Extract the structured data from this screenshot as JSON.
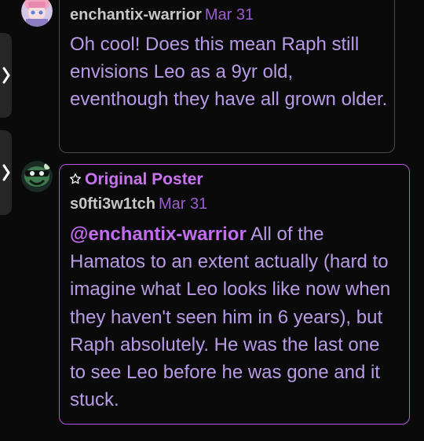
{
  "comments": [
    {
      "username": "enchantix-warrior",
      "date": "Mar 31",
      "text": "Oh cool! Does this mean Raph still envisions Leo as a 9yr old, eventhough they have all grown older."
    },
    {
      "badge": "Original Poster",
      "username": "s0fti3w1tch",
      "date": "Mar 31",
      "mention": "@enchantix-warrior",
      "text": " All of the Hamatos to an extent actually (hard to imagine what Leo looks like now when they haven't seen him in 6 years), but Raph absolutely.  He was the last one to see Leo before he was gone and it stuck."
    }
  ],
  "icons": {
    "side_tab": "chevron-right-icon",
    "badge": "star-icon"
  },
  "colors": {
    "background": "#0a0a0a",
    "username": "#c7c7c7",
    "date": "#9b5ccf",
    "body_text": "#b79be6",
    "mention": "#c46cf0",
    "op_border": "#b356e0"
  }
}
